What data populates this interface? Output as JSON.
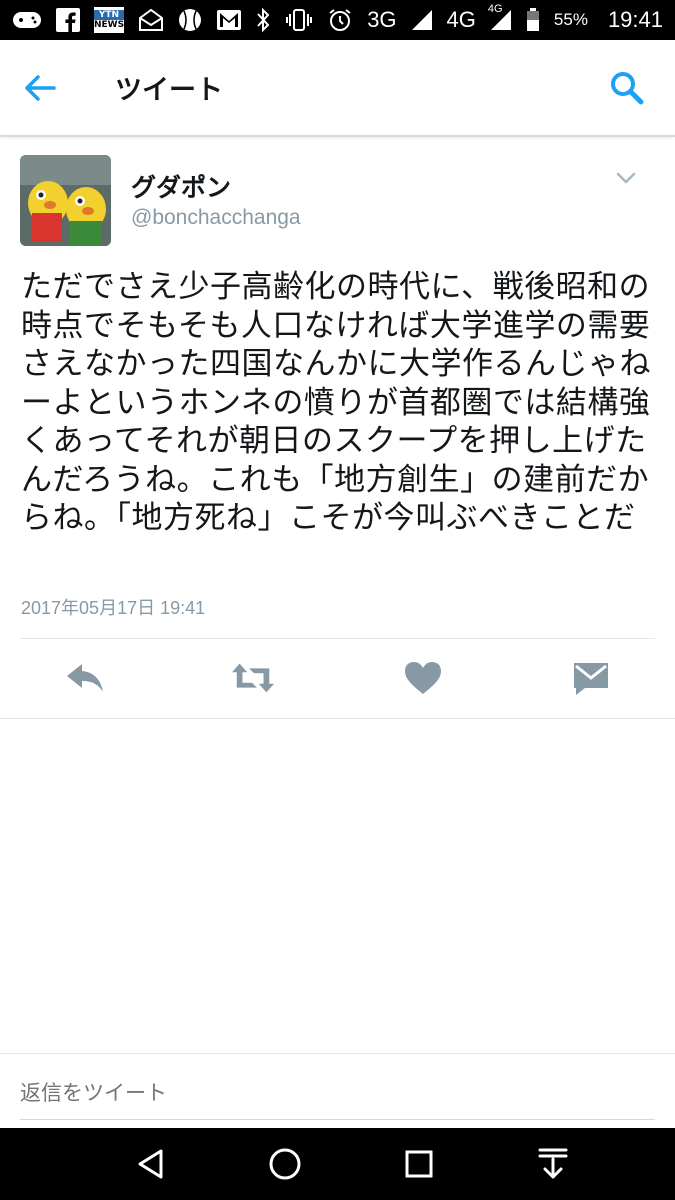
{
  "status_bar": {
    "network_3g": "3G",
    "network_4g": "4G",
    "network_4g_small": "4G",
    "battery": "55%",
    "time": "19:41",
    "ytn_top": "YTN",
    "ytn_bottom": "NEWS"
  },
  "header": {
    "title": "ツイート",
    "accent_color": "#1da1f2"
  },
  "tweet": {
    "display_name": "グダポン",
    "handle": "@bonchacchanga",
    "text": "ただでさえ少子高齢化の時代に、戦後昭和の時点でそもそも人口なければ大学進学の需要さえなかった四国なんかに大学作るんじゃねーよというホンネの憤りが首都圏では結構強くあってそれが朝日のスクープを押し上げたんだろうね。これも「地方創生」の建前だからね。「地方死ね」こそが今叫ぶべきことだ",
    "timestamp": "2017年05月17日 19:41"
  },
  "actions": [
    "reply-icon",
    "retweet-icon",
    "like-icon",
    "direct-message-icon"
  ],
  "reply": {
    "placeholder": "返信をツイート"
  },
  "nav": [
    "back-triangle-icon",
    "home-circle-icon",
    "recents-square-icon",
    "notifications-down-icon"
  ]
}
